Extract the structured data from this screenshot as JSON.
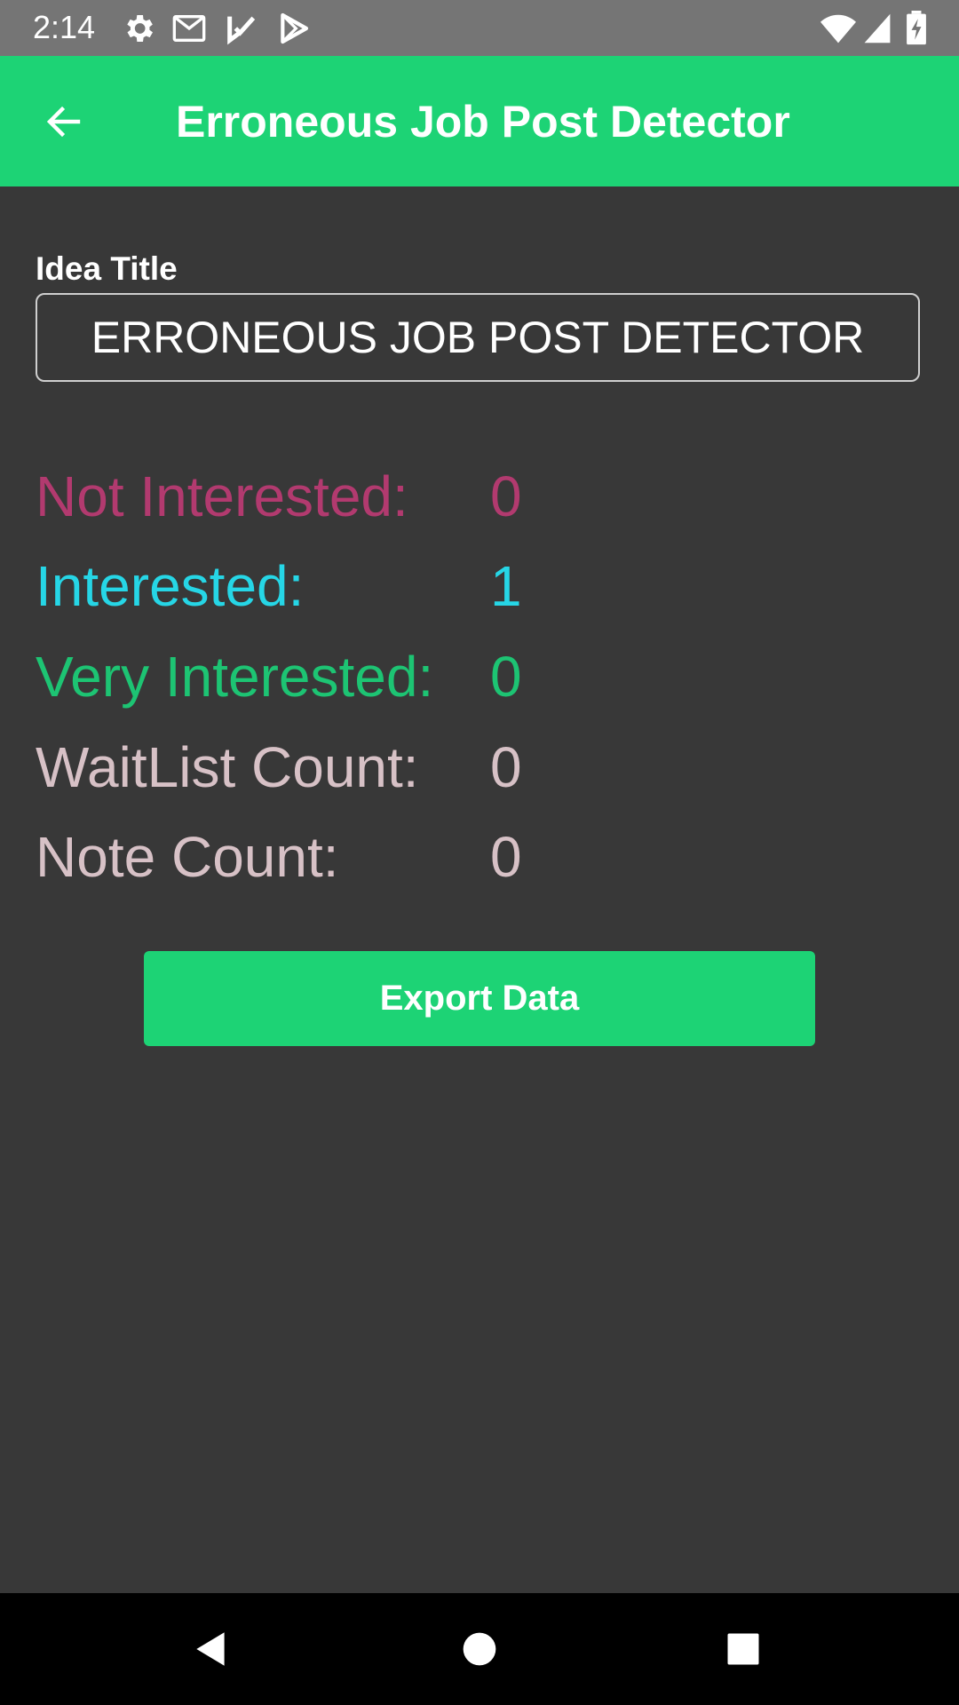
{
  "status_bar": {
    "time": "2:14",
    "icons": [
      "settings-icon",
      "gmail-icon",
      "check-app-icon",
      "play-store-icon",
      "wifi-icon",
      "cell-signal-icon",
      "battery-charging-icon"
    ]
  },
  "app_bar": {
    "title": "Erroneous Job Post Detector",
    "back_icon": "arrow-back-icon"
  },
  "form": {
    "idea_title_label": "Idea Title",
    "idea_title_value": "ERRONEOUS JOB POST DETECTOR"
  },
  "stats": [
    {
      "label": "Not Interested:",
      "value": "0",
      "color": "#b23a6f"
    },
    {
      "label": "Interested:",
      "value": "1",
      "color": "#26d6e6"
    },
    {
      "label": "Very Interested:",
      "value": "0",
      "color": "#1dc473"
    },
    {
      "label": "WaitList Count:",
      "value": "0",
      "color": "#d7c1c6"
    },
    {
      "label": "Note Count:",
      "value": "0",
      "color": "#d7c1c6"
    }
  ],
  "actions": {
    "export_label": "Export Data"
  },
  "colors": {
    "accent": "#1dd375",
    "background": "#383838",
    "status_bar": "#757575"
  },
  "nav_bar": {
    "icons": [
      "nav-back-icon",
      "nav-home-icon",
      "nav-recents-icon"
    ]
  }
}
